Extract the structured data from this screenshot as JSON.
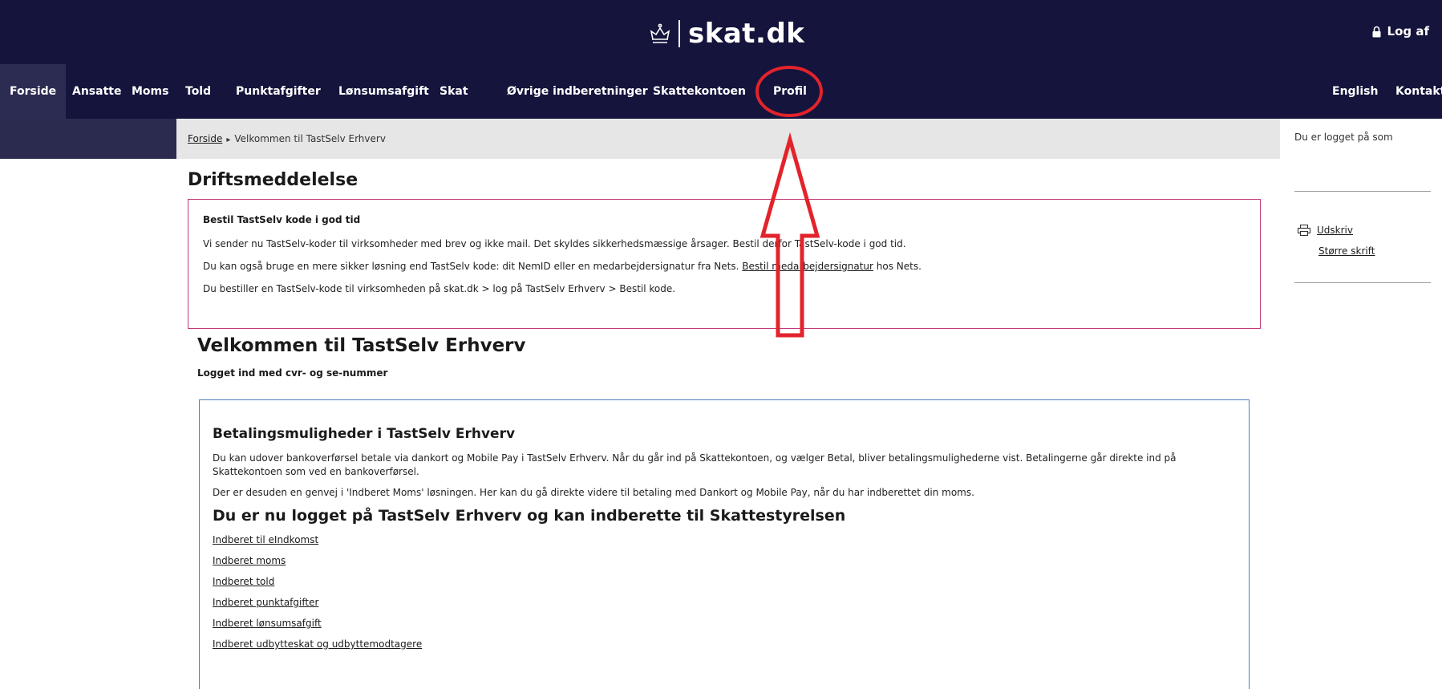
{
  "header": {
    "brand": "skat.dk",
    "logoff_label": "Log af"
  },
  "nav": {
    "items": [
      "Forside",
      "Ansatte",
      "Moms",
      "Told",
      "Punktafgifter",
      "Lønsumsafgift",
      "Skat",
      "Øvrige indberetninger",
      "Skattekontoen",
      "Profil"
    ],
    "right": [
      "English",
      "Kontakt"
    ]
  },
  "breadcrumb": {
    "home": "Forside",
    "current": "Velkommen til TastSelv Erhverv"
  },
  "aside": {
    "logged_in": "Du er logget på som",
    "print": "Udskriv",
    "bigger_text": "Større skrift"
  },
  "notice": {
    "heading": "Driftsmeddelelse",
    "title": "Bestil TastSelv kode i god tid",
    "line1": "Vi sender nu TastSelv-koder til virksomheder med brev og ikke mail. Det skyldes sikkerhedsmæssige årsager. Bestil derfor TastSelv-kode i god tid.",
    "line2_pre": "Du kan også bruge en mere sikker løsning end TastSelv kode: dit NemID eller en medarbejdersignatur fra Nets.",
    "line2_link": "Bestil medarbejdersignatur",
    "line2_post": "hos Nets.",
    "line3": "Du bestiller en TastSelv-kode til virksomheden på skat.dk > log på TastSelv Erhverv > Bestil kode."
  },
  "welcome": {
    "title": "Velkommen til TastSelv Erhverv",
    "subtitle": "Logget ind med cvr- og se-nummer"
  },
  "payment": {
    "title": "Betalingsmuligheder i TastSelv Erhverv",
    "text1": "Du kan udover bankoverførsel betale via dankort og Mobile Pay i TastSelv Erhverv. Når du går ind på Skattekontoen, og vælger Betal, bliver betalingsmulighederne vist. Betalingerne går direkte ind på Skattekontoen som ved en bankoverførsel.",
    "text2": "Der er desuden en genvej i 'Indberet Moms' løsningen. Her kan du gå direkte videre til betaling med Dankort og Mobile Pay, når du har indberettet din moms."
  },
  "report": {
    "title": "Du er nu logget på TastSelv Erhverv og kan indberette til Skattestyrelsen",
    "links": [
      "Indberet til eIndkomst",
      "Indberet moms",
      "Indberet told",
      "Indberet punktafgifter",
      "Indberet lønsumsafgift",
      "Indberet udbytteskat og udbyttemodtagere"
    ]
  },
  "colors": {
    "header_bg": "#14143c",
    "annotation": "#e3232b",
    "notice_border": "#c0397b",
    "box_border": "#4a7fc1"
  },
  "icons": [
    "crown-icon",
    "lock-icon",
    "printer-icon"
  ]
}
